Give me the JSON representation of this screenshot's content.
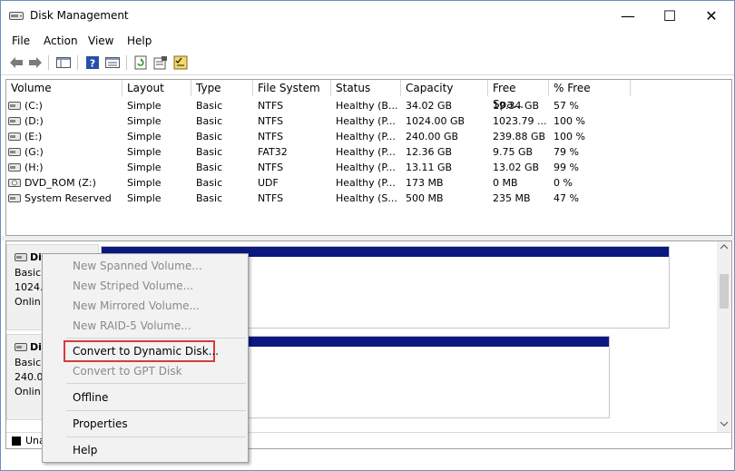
{
  "window": {
    "title": "Disk Management",
    "minimize_glyph": "—",
    "maximize_glyph": "☐",
    "close_glyph": "✕"
  },
  "menu": [
    "File",
    "Action",
    "View",
    "Help"
  ],
  "columns": [
    "Volume",
    "Layout",
    "Type",
    "File System",
    "Status",
    "Capacity",
    "Free Spa...",
    "% Free"
  ],
  "volumes": [
    {
      "volume": "(C:)",
      "layout": "Simple",
      "type": "Basic",
      "fs": "NTFS",
      "status": "Healthy (B...",
      "capacity": "34.02 GB",
      "free": "19.34 GB",
      "pct": "57 %",
      "icon": "drive-icon"
    },
    {
      "volume": "(D:)",
      "layout": "Simple",
      "type": "Basic",
      "fs": "NTFS",
      "status": "Healthy (P...",
      "capacity": "1024.00 GB",
      "free": "1023.79 ...",
      "pct": "100 %",
      "icon": "drive-icon"
    },
    {
      "volume": "(E:)",
      "layout": "Simple",
      "type": "Basic",
      "fs": "NTFS",
      "status": "Healthy (P...",
      "capacity": "240.00 GB",
      "free": "239.88 GB",
      "pct": "100 %",
      "icon": "drive-icon"
    },
    {
      "volume": "(G:)",
      "layout": "Simple",
      "type": "Basic",
      "fs": "FAT32",
      "status": "Healthy (P...",
      "capacity": "12.36 GB",
      "free": "9.75 GB",
      "pct": "79 %",
      "icon": "drive-icon"
    },
    {
      "volume": "(H:)",
      "layout": "Simple",
      "type": "Basic",
      "fs": "NTFS",
      "status": "Healthy (P...",
      "capacity": "13.11 GB",
      "free": "13.02 GB",
      "pct": "99 %",
      "icon": "drive-icon"
    },
    {
      "volume": "DVD_ROM (Z:)",
      "layout": "Simple",
      "type": "Basic",
      "fs": "UDF",
      "status": "Healthy (P...",
      "capacity": "173 MB",
      "free": "0 MB",
      "pct": "0 %",
      "icon": "dvd-icon"
    },
    {
      "volume": "System Reserved",
      "layout": "Simple",
      "type": "Basic",
      "fs": "NTFS",
      "status": "Healthy (S...",
      "capacity": "500 MB",
      "free": "235 MB",
      "pct": "47 %",
      "icon": "drive-icon"
    }
  ],
  "disks": [
    {
      "name": "Di",
      "type": "Basic",
      "size": "1024.0",
      "state": "Onlin"
    },
    {
      "name": "Di",
      "type": "Basic",
      "size": "240.0",
      "state": "Onlin"
    }
  ],
  "legend": {
    "label": "Una",
    "color": "#000000"
  },
  "context_menu": [
    {
      "label": "New Spanned Volume...",
      "enabled": false
    },
    {
      "label": "New Striped Volume...",
      "enabled": false
    },
    {
      "label": "New Mirrored Volume...",
      "enabled": false
    },
    {
      "label": "New RAID-5 Volume...",
      "enabled": false
    },
    {
      "label": "Convert to Dynamic Disk...",
      "enabled": true,
      "highlighted": true
    },
    {
      "label": "Convert to GPT Disk",
      "enabled": false
    },
    {
      "label": "Offline",
      "enabled": true
    },
    {
      "label": "Properties",
      "enabled": true
    },
    {
      "label": "Help",
      "enabled": true
    }
  ],
  "colors": {
    "volume_stripe": "#0a1880",
    "highlight": "#d93a3a",
    "menu_bg": "#f2f2f2"
  }
}
